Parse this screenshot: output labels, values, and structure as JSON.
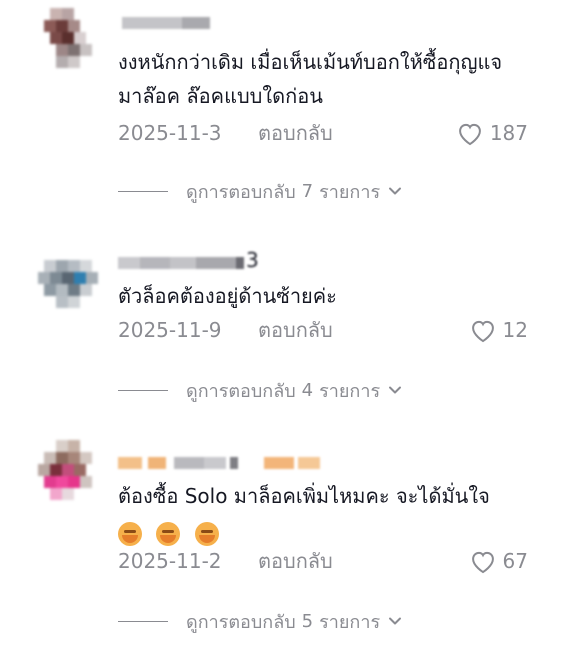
{
  "comments": [
    {
      "text": "งงหนักกว่าเดิม เมื่อเห็นเม้นท์บอกให้ซื้อกุญแจมาล๊อค ล๊อคแบบใดก่อน",
      "date": "2025-11-3",
      "reply_label": "ตอบกลับ",
      "likes": "187",
      "view_replies": {
        "prefix": "ดูการตอบกลับ",
        "count": "7",
        "suffix": "รายการ"
      }
    },
    {
      "username_tail": "3",
      "text": "ตัวล็อคต้องอยู่ด้านซ้ายค่ะ",
      "date": "2025-11-9",
      "reply_label": "ตอบกลับ",
      "likes": "12",
      "view_replies": {
        "prefix": "ดูการตอบกลับ",
        "count": "4",
        "suffix": "รายการ"
      }
    },
    {
      "text": "ต้องซื้อ Solo มาล็อคเพิ่มไหมคะ จะได้มั่นใจ",
      "emojis": [
        "smiling-face-with-hand-over-mouth",
        "smiling-face-with-hand-over-mouth",
        "smiling-face-with-hand-over-mouth"
      ],
      "date": "2025-11-2",
      "reply_label": "ตอบกลับ",
      "likes": "67",
      "view_replies": {
        "prefix": "ดูการตอบกลับ",
        "count": "5",
        "suffix": "รายการ"
      }
    }
  ],
  "colors": {
    "text": "#161823",
    "secondary": "#8a8b91",
    "background": "#ffffff"
  }
}
